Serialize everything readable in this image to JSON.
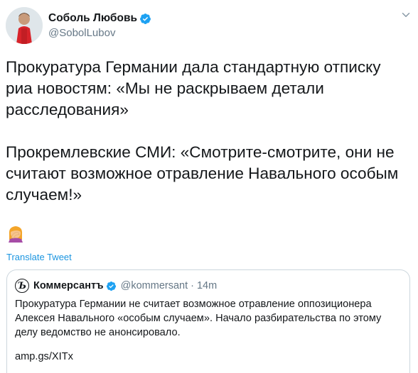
{
  "author": {
    "name": "Соболь Любовь",
    "handle": "@SobolLubov",
    "verified": true
  },
  "tweet": {
    "paragraph1": "Прокуратура Германии дала стандартную отписку риа новостям: «Мы не раскрываем детали расследования»",
    "paragraph2": "Прокремлевские СМИ: «Смотрите-смотрите, они не считают возможное отравление Навального особым случаем!»",
    "emoji": "woman-facepalming"
  },
  "translate_label": "Translate Tweet",
  "quoted": {
    "avatar_letter": "Ъ",
    "name": "Коммерсантъ",
    "verified": true,
    "handle": "@kommersant",
    "separator": "·",
    "time": "14m",
    "text": "Прокуратура Германии не считает возможное отравление оппозиционера Алексея Навального «особым случаем». Начало разбирательства по этому делу ведомство не анонсировало.",
    "link": "amp.gs/XITx"
  },
  "colors": {
    "accent": "#1b95e0",
    "verified": "#1da1f2",
    "secondary_text": "#657786",
    "border": "#ccd6dd"
  }
}
